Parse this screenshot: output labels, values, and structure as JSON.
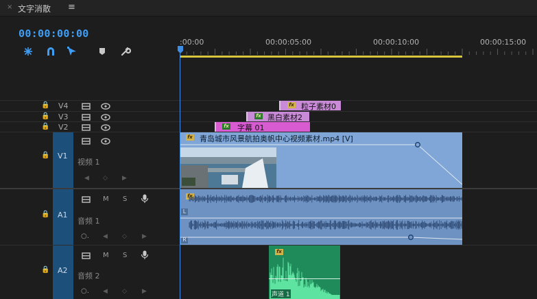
{
  "panel": {
    "close_glyph": "×",
    "title": "文字消散",
    "menu_glyph": "≡"
  },
  "timecode": "00:00:00:00",
  "toolbar": {
    "icons": [
      "snap-icon",
      "magnet-link-icon",
      "linked-selection-icon",
      "add-marker-icon",
      "wrench-icon"
    ]
  },
  "ruler": {
    "labels": [
      ":00:00",
      "00:00:05:00",
      "00:00:10:00",
      "00:00:15:00"
    ]
  },
  "tracks": {
    "v4": {
      "lock": "🔒",
      "name": "V4"
    },
    "v3": {
      "lock": "🔒",
      "name": "V3"
    },
    "v2": {
      "lock": "🔒",
      "name": "V2"
    },
    "v1": {
      "lock": "🔒",
      "name": "V1",
      "label": "视频 1"
    },
    "a1": {
      "lock": "🔒",
      "name": "A1",
      "label": "音频 1",
      "m": "M",
      "s": "S"
    },
    "a2": {
      "lock": "🔒",
      "name": "A2",
      "label": "音频 2",
      "m": "M",
      "s": "S"
    }
  },
  "clips": {
    "particle": {
      "fx": "fx",
      "label": "粒子素材0"
    },
    "bw": {
      "fx": "fx",
      "label": "黑白素材2"
    },
    "caption": {
      "fx": "fx",
      "label": "字幕 01"
    },
    "video": {
      "fx": "fx",
      "label": "青岛城市风景航拍奥帆中心视频素材.mp4 [V]"
    },
    "audio_a1": {
      "fx": "fx",
      "channel_l": "L",
      "channel_r": "R"
    },
    "audio_a2": {
      "fx": "fx",
      "label": "声道 1"
    }
  },
  "colors": {
    "accent": "#3f9ef5",
    "video_clip": "#7fa6d6",
    "audio_clip": "#6e93c3",
    "graphic_clip": "#c98bd8",
    "caption_clip": "#d95bd2",
    "green_clip": "#1f8a5a",
    "work_area": "#d7c63b"
  }
}
